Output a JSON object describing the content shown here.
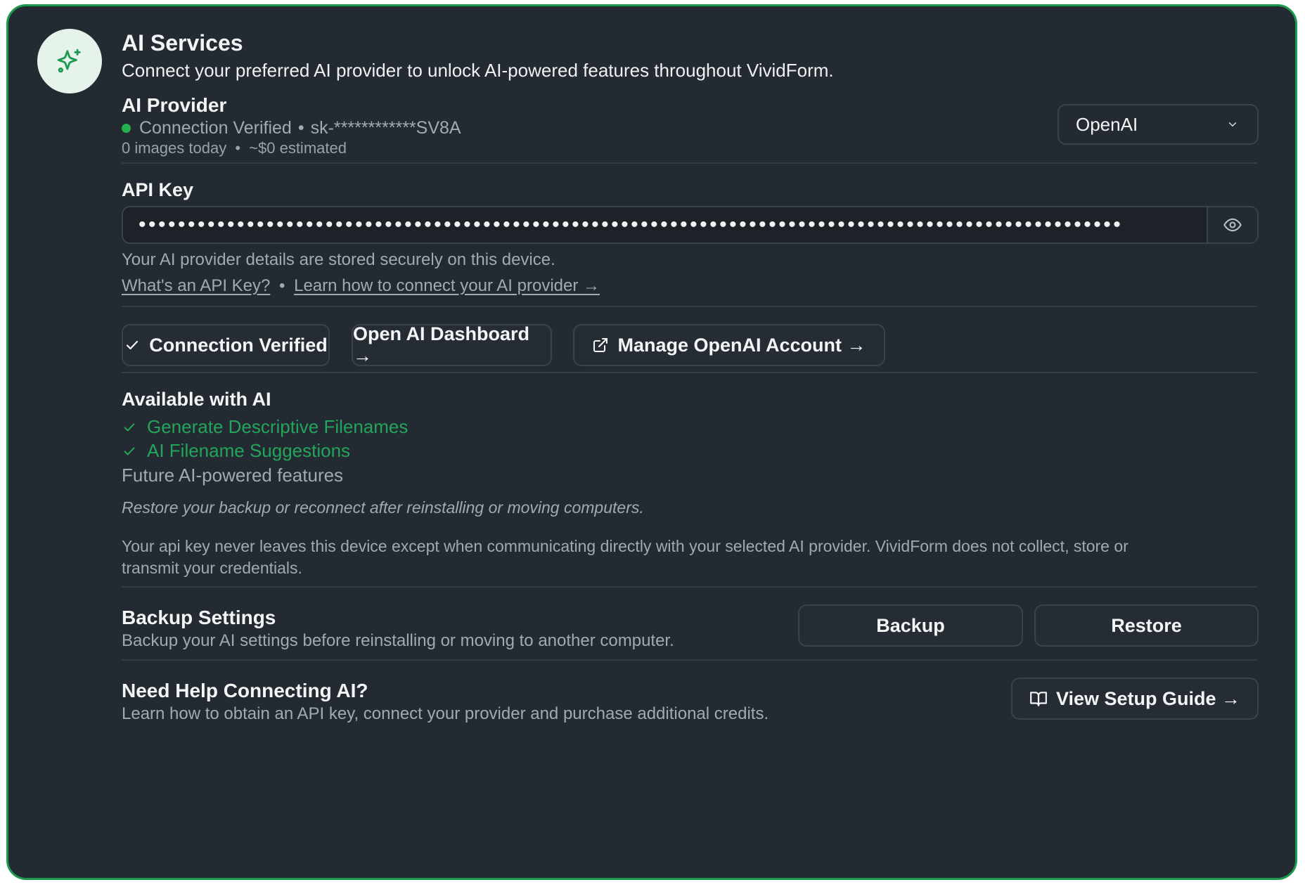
{
  "header": {
    "title": "AI Services",
    "subtitle": "Connect your preferred AI provider to unlock AI-powered features throughout VividForm.",
    "icon": "sparkles-icon",
    "accent_color": "#1e9a4f"
  },
  "provider": {
    "label": "AI Provider",
    "status_text": "Connection Verified",
    "separator": "•",
    "masked_key": "sk-************SV8A",
    "usage_images": "0 images today",
    "usage_cost": "~$0 estimated",
    "selected": "OpenAI",
    "status_color": "#22b14c"
  },
  "api_key": {
    "label": "API Key",
    "value": "••••••••••••••••••••••••••••••••••••••••••••••••••••••••••••••••••••••••••••••••••••••••••••••••••••",
    "stored_note": "Your AI provider details are stored securely on this device.",
    "link_what": "What's an API Key?",
    "link_separator": "•",
    "link_learn": "Learn how to connect your AI provider →"
  },
  "actions": {
    "verified": "Connection Verified",
    "dashboard": "Open AI Dashboard →",
    "manage": "Manage OpenAI Account →"
  },
  "features": {
    "heading": "Available with AI",
    "items": [
      {
        "label": "Generate Descriptive Filenames"
      },
      {
        "label": "AI Filename Suggestions"
      }
    ],
    "future": "Future AI-powered features",
    "restore_note": "Restore your backup or reconnect after reinstalling or moving computers.",
    "privacy_line1": "Your api key never leaves this device except when communicating directly with your selected AI provider. VividForm does not collect, store or",
    "privacy_line2": "transmit your credentials."
  },
  "backup": {
    "heading": "Backup Settings",
    "description": "Backup your AI settings before reinstalling or moving to another computer.",
    "backup_label": "Backup",
    "restore_label": "Restore"
  },
  "help": {
    "heading": "Need Help Connecting AI?",
    "description": "Learn how to obtain an API key, connect your provider and purchase additional credits.",
    "guide_label": "View Setup Guide →"
  }
}
